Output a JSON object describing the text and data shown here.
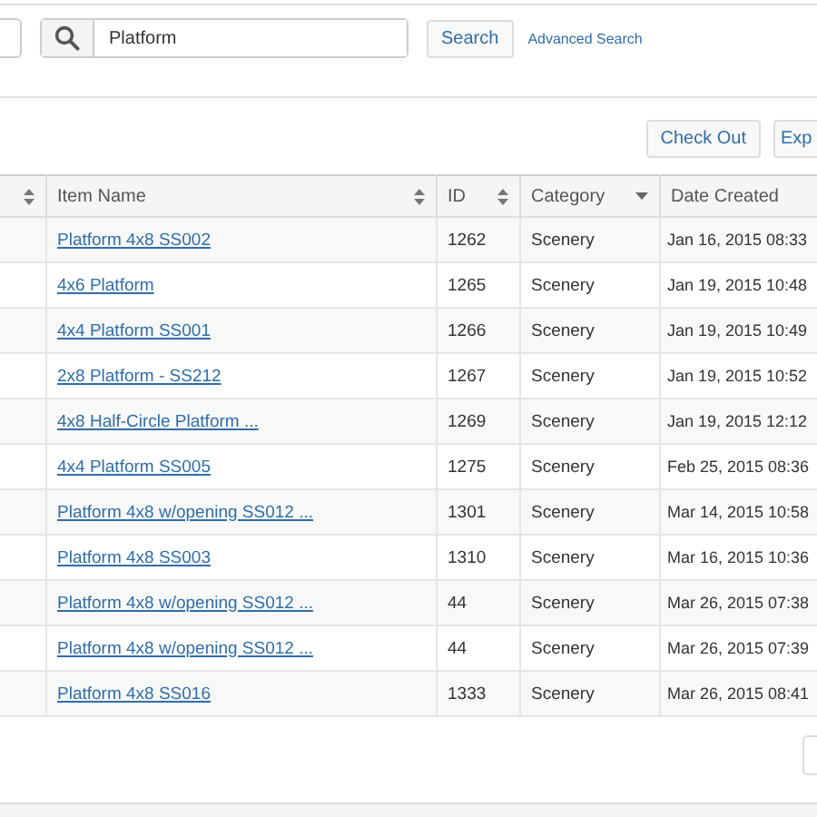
{
  "search": {
    "value": "Platform",
    "button": "Search",
    "advanced_link": "Advanced Search"
  },
  "toolbar": [
    "Check Out",
    "Exp"
  ],
  "table": {
    "columns": [
      {
        "sortable": true,
        "sorted": false
      },
      {
        "label": "Item Name",
        "sortable": true,
        "sorted": false
      },
      {
        "label": "ID",
        "sortable": true,
        "sorted": false
      },
      {
        "label": "Category",
        "sortable": true,
        "sorted": true
      },
      {
        "label": "Date Created",
        "sortable": false,
        "sorted": false
      }
    ],
    "rows": [
      {
        "name": "Platform 4x8 SS002",
        "id": "1262",
        "category": "Scenery",
        "date": "Jan 16, 2015 08:33"
      },
      {
        "name": "4x6 Platform",
        "id": "1265",
        "category": "Scenery",
        "date": "Jan 19, 2015 10:48"
      },
      {
        "name": "4x4 Platform SS001",
        "id": "1266",
        "category": "Scenery",
        "date": "Jan 19, 2015 10:49"
      },
      {
        "name": "2x8 Platform - SS212",
        "id": "1267",
        "category": "Scenery",
        "date": "Jan 19, 2015 10:52"
      },
      {
        "name": "4x8 Half-Circle Platform ...",
        "id": "1269",
        "category": "Scenery",
        "date": "Jan 19, 2015 12:12"
      },
      {
        "name": "4x4 Platform SS005",
        "id": "1275",
        "category": "Scenery",
        "date": "Feb 25, 2015 08:36"
      },
      {
        "name": "Platform 4x8 w/opening SS012 ...",
        "id": "1301",
        "category": "Scenery",
        "date": "Mar 14, 2015 10:58"
      },
      {
        "name": "Platform 4x8 SS003",
        "id": "1310",
        "category": "Scenery",
        "date": "Mar 16, 2015 10:36"
      },
      {
        "name": "Platform 4x8 w/opening SS012 ...",
        "id": "44",
        "category": "Scenery",
        "date": "Mar 26, 2015 07:38"
      },
      {
        "name": "Platform 4x8 w/opening SS012 ...",
        "id": "44",
        "category": "Scenery",
        "date": "Mar 26, 2015 07:39"
      },
      {
        "name": "Platform 4x8 SS016",
        "id": "1333",
        "category": "Scenery",
        "date": "Mar 26, 2015 08:41"
      }
    ]
  }
}
